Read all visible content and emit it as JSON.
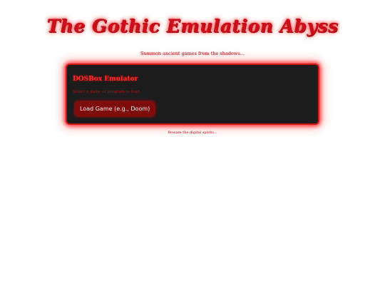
{
  "header": {
    "title": "The Gothic Emulation Abyss",
    "subtitle": "Summon ancient games from the shadows..."
  },
  "emulator": {
    "title": "DOSBox Emulator",
    "instructions": "Select a game or program to load",
    "load_button_label": "Load Game (e.g., Doom)"
  },
  "footer": {
    "text": "Beware the digital spirits..."
  },
  "colors": {
    "accent": "#c8101c",
    "panel_background": "#1c1c1c",
    "button_background": "#7e0a0a",
    "page_background": "#ffffff"
  }
}
